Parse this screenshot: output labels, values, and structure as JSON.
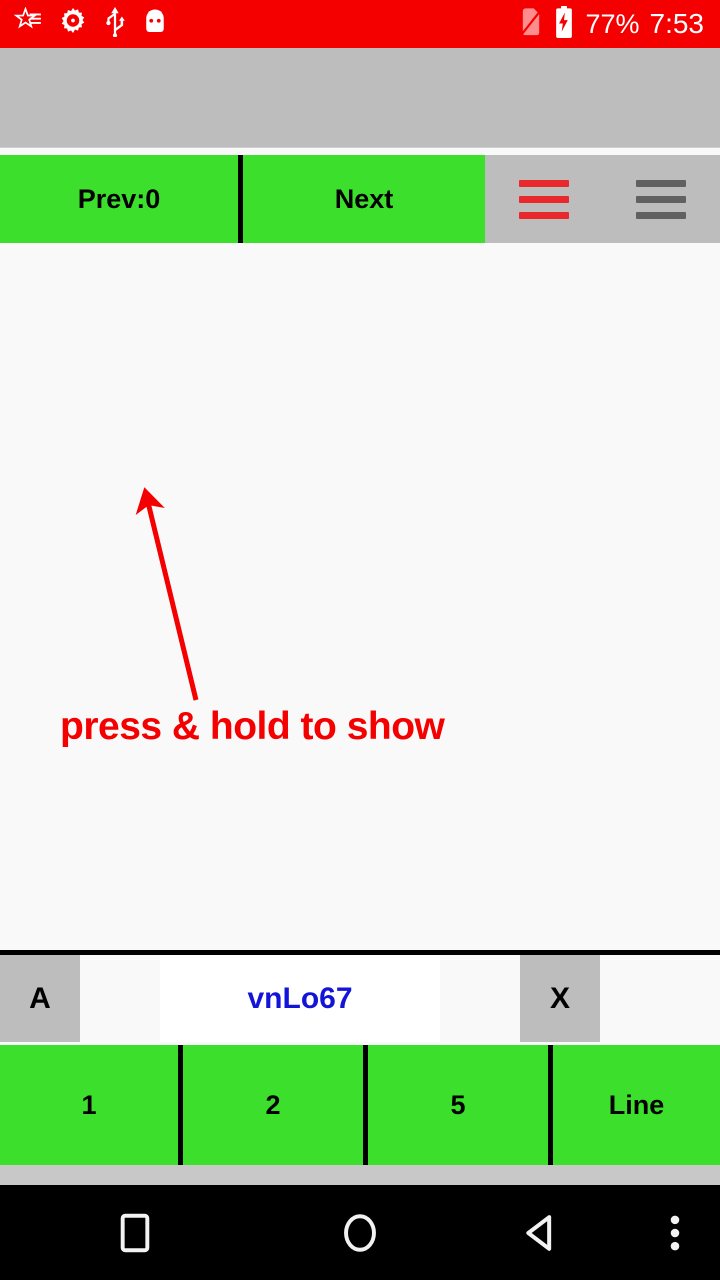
{
  "status_bar": {
    "background_color": "#f40000",
    "text_color": "#ffffff",
    "left_icons": [
      {
        "name": "sheriff-star-icon",
        "label": "star badge"
      },
      {
        "name": "gear-icon",
        "label": "settings gear"
      },
      {
        "name": "usb-icon",
        "label": "usb connected"
      },
      {
        "name": "android-head-icon",
        "label": "android robot"
      }
    ],
    "right_icons": [
      {
        "name": "no-sim-icon",
        "label": "no sim card"
      },
      {
        "name": "battery-charging-icon",
        "label": "battery charging"
      }
    ],
    "battery_percent": "77%",
    "time": "7:53"
  },
  "nav_row": {
    "prev_label": "Prev:0",
    "next_label": "Next",
    "menu_red_name": "hamburger-menu-red",
    "menu_grey_name": "hamburger-menu-grey",
    "green_color": "#3cdf2b",
    "grey_color": "#bdbdbd"
  },
  "annotation": {
    "text": "press & hold to show",
    "color": "#f40000",
    "points_to": "Prev:0"
  },
  "input_row": {
    "left_button_label": "A",
    "right_button_label": "X",
    "field_value": "vnLo67",
    "field_placeholder": "",
    "field_text_color": "#1414d8"
  },
  "key_row": {
    "keys": [
      {
        "label": "1"
      },
      {
        "label": "2"
      },
      {
        "label": "5"
      },
      {
        "label": "Line"
      }
    ]
  },
  "android_nav": {
    "recents_label": "recents",
    "home_label": "home",
    "back_label": "back",
    "overflow_label": "more options"
  }
}
